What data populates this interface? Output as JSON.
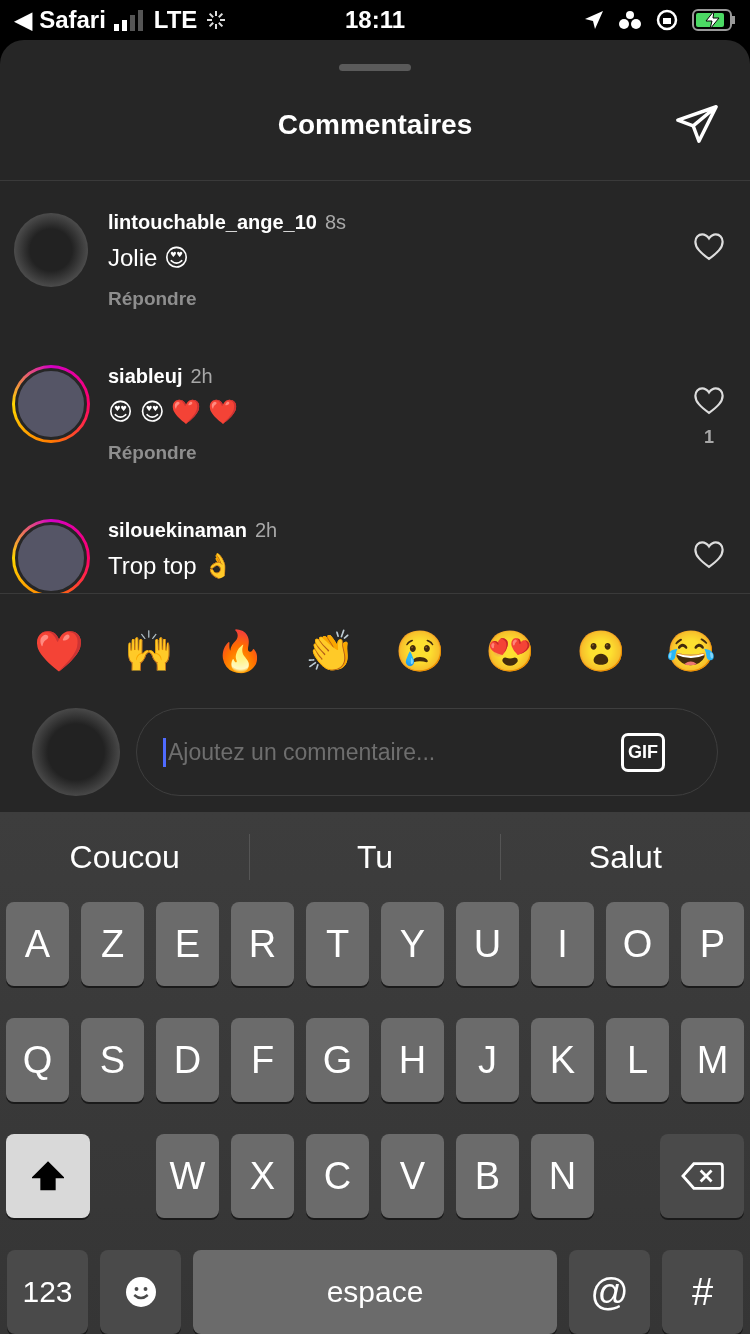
{
  "status_bar": {
    "back_app": "◀ Safari",
    "network": "LTE",
    "time": "18:11"
  },
  "sheet": {
    "title": "Commentaires"
  },
  "comments": [
    {
      "username": "lintouchable_ange_10",
      "age": "8s",
      "text": "Jolie 😍",
      "reply": "Répondre",
      "story_ring": false,
      "liked": false
    },
    {
      "username": "siableuj",
      "age": "2h",
      "text": "😍 😍 ❤️ ❤️",
      "reply": "Répondre",
      "story_ring": true,
      "liked": false,
      "likes": "1"
    },
    {
      "username": "silouekinaman",
      "age": "2h",
      "text": "Trop top 👌",
      "story_ring": true,
      "liked": false
    }
  ],
  "reactions": [
    "❤️",
    "🙌",
    "🔥",
    "👏",
    "😢",
    "😍",
    "😮",
    "😂"
  ],
  "composer": {
    "placeholder": "Ajoutez un commentaire...",
    "gif": "GIF"
  },
  "keyboard": {
    "suggestions": [
      "Coucou",
      "Tu",
      "Salut"
    ],
    "top_row": {
      "keys": [
        "A",
        "Z",
        "E",
        "R",
        "T",
        "Y",
        "U",
        "I",
        "O",
        "P"
      ]
    },
    "middle_row": {
      "keys": [
        "Q",
        "S",
        "D",
        "F",
        "G",
        "H",
        "J",
        "K",
        "L",
        "M"
      ]
    },
    "bottom_row": {
      "keys": [
        "W",
        "X",
        "C",
        "V",
        "B",
        "N"
      ]
    },
    "numbers": "123",
    "space": "espace",
    "at": "@",
    "hash": "#",
    "shift_on": true
  }
}
